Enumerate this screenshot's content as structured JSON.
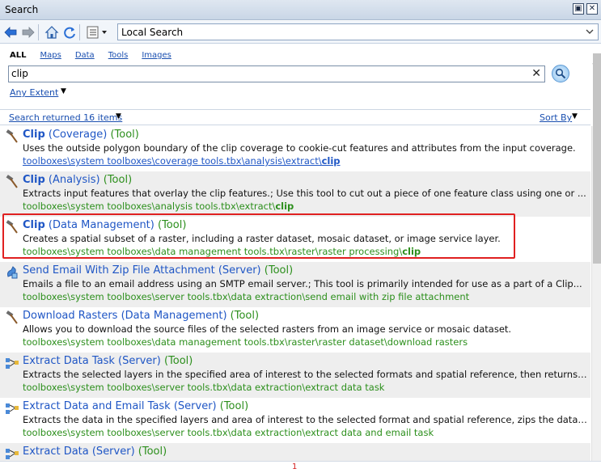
{
  "window": {
    "title": "Search"
  },
  "toolbar": {
    "location": "Local Search"
  },
  "tabs": [
    {
      "label": "ALL",
      "active": true
    },
    {
      "label": "Maps",
      "active": false
    },
    {
      "label": "Data",
      "active": false
    },
    {
      "label": "Tools",
      "active": false
    },
    {
      "label": "Images",
      "active": false
    }
  ],
  "search": {
    "value": "clip",
    "extent": "Any Extent"
  },
  "results": {
    "count_label": "Search returned 16 items",
    "sort_label": "Sort By",
    "items": [
      {
        "icon": "hammer-icon",
        "name_bold": "Clip",
        "name_rest": " (Coverage)",
        "kind": " (Tool)",
        "desc": "Uses the outside polygon boundary of the clip coverage to cookie-cut features and attributes from the input coverage.",
        "path_pre": "toolboxes\\system toolboxes\\coverage tools.tbx\\analysis\\extract\\",
        "path_bold": "clip",
        "path_style": "blue"
      },
      {
        "icon": "hammer-icon",
        "name_bold": "Clip",
        "name_rest": " (Analysis)",
        "kind": " (Tool)",
        "desc": "Extracts input features that overlay the clip features.; Use this tool to cut out a piece of one feature class using one or ...",
        "path_pre": "toolboxes\\system toolboxes\\analysis tools.tbx\\extract\\",
        "path_bold": "clip",
        "path_style": "green"
      },
      {
        "icon": "hammer-icon",
        "name_bold": "Clip",
        "name_rest": " (Data Management)",
        "kind": " (Tool)",
        "desc": "Creates a spatial subset of a raster, including a raster dataset, mosaic dataset, or image service layer.",
        "path_pre": "toolboxes\\system toolboxes\\data management tools.tbx\\raster\\raster processing\\",
        "path_bold": "clip",
        "path_style": "green"
      },
      {
        "icon": "server-tool-icon",
        "name_bold": "",
        "name_rest": "Send Email With Zip File Attachment (Server)",
        "kind": " (Tool)",
        "desc": "Emails a file to an email address using an SMTP email server.; This tool is primarily intended for use as a part of a Clip...",
        "path_pre": "toolboxes\\system toolboxes\\server tools.tbx\\data extraction\\send email with zip file attachment",
        "path_bold": "",
        "path_style": "green"
      },
      {
        "icon": "hammer-icon",
        "name_bold": "",
        "name_rest": "Download Rasters (Data Management)",
        "kind": " (Tool)",
        "desc": "Allows you to download the source files of the selected rasters from an image service or mosaic dataset.",
        "path_pre": "toolboxes\\system toolboxes\\data management tools.tbx\\raster\\raster dataset\\download rasters",
        "path_bold": "",
        "path_style": "green"
      },
      {
        "icon": "model-icon",
        "name_bold": "",
        "name_rest": "Extract Data Task (Server)",
        "kind": " (Tool)",
        "desc": "Extracts the selected layers in the specified area of interest to the selected formats and spatial reference, then returns ...",
        "path_pre": "toolboxes\\system toolboxes\\server tools.tbx\\data extraction\\extract data task",
        "path_bold": "",
        "path_style": "green"
      },
      {
        "icon": "model-icon",
        "name_bold": "",
        "name_rest": "Extract Data and Email Task (Server)",
        "kind": " (Tool)",
        "desc": "Extracts the data in the specified layers and area of interest to the selected format and spatial reference, zips the data,...",
        "path_pre": "toolboxes\\system toolboxes\\server tools.tbx\\data extraction\\extract data and email task",
        "path_bold": "",
        "path_style": "green"
      },
      {
        "icon": "model-icon",
        "name_bold": "",
        "name_rest": "Extract Data (Server)",
        "kind": " (Tool)",
        "desc": "",
        "path_pre": "",
        "path_bold": "",
        "path_style": "green"
      }
    ]
  },
  "footer": {
    "page_number": "1"
  },
  "colors": {
    "link_blue": "#1f56c5",
    "tool_green": "#2c8f1c",
    "highlight_red": "#e02020"
  }
}
